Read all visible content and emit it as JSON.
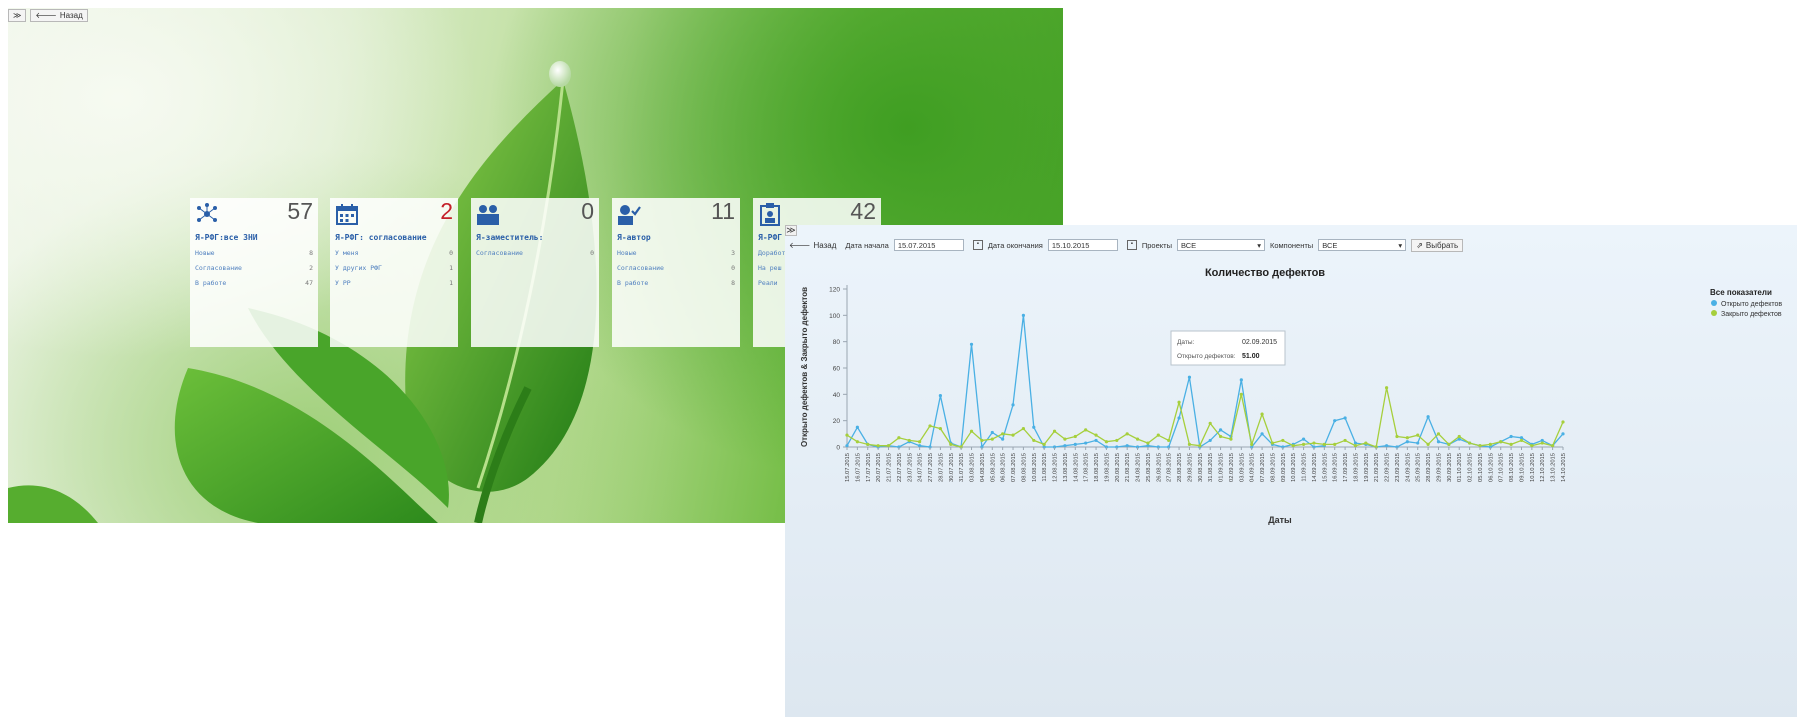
{
  "dashboard": {
    "expand_glyph": "≫",
    "back_label": "Назад",
    "tiles": [
      {
        "count": "57",
        "count_color": "#555555",
        "icon": "network-icon",
        "title": "Я-РФГ:все ЗНИ",
        "rows": [
          {
            "label": "Новые",
            "value": "8"
          },
          {
            "label": "Согласование",
            "value": "2"
          },
          {
            "label": "В работе",
            "value": "47"
          }
        ]
      },
      {
        "count": "2",
        "count_color": "#c4202a",
        "icon": "calendar-icon",
        "title": "Я-РФГ: согласование",
        "rows": [
          {
            "label": "У меня",
            "value": "0"
          },
          {
            "label": "У других РФГ",
            "value": "1"
          },
          {
            "label": "У РР",
            "value": "1"
          }
        ]
      },
      {
        "count": "0",
        "count_color": "#555555",
        "icon": "users-icon",
        "title": "Я-заместитель:",
        "rows": [
          {
            "label": "Согласование",
            "value": "0"
          }
        ]
      },
      {
        "count": "11",
        "count_color": "#555555",
        "icon": "user-check-icon",
        "title": "Я-автор",
        "rows": [
          {
            "label": "Новые",
            "value": "3"
          },
          {
            "label": "Согласование",
            "value": "0"
          },
          {
            "label": "В работе",
            "value": "8"
          }
        ]
      },
      {
        "count": "42",
        "count_color": "#555555",
        "icon": "clipboard-user-icon",
        "title": "Я-РФГ",
        "rows": [
          {
            "label": "Доработ",
            "value": ""
          },
          {
            "label": "На реш",
            "value": ""
          },
          {
            "label": "Реали",
            "value": ""
          }
        ]
      }
    ]
  },
  "chart_window": {
    "expand_glyph": "≫",
    "back_label": "Назад",
    "start_label": "Дата начала",
    "start_value": "15.07.2015",
    "end_label": "Дата окончания",
    "end_value": "15.10.2015",
    "projects_label": "Проекты",
    "projects_value": "ВСЕ",
    "components_label": "Компоненты",
    "components_value": "ВСЕ",
    "select_label": "Выбрать",
    "legend_title": "Все показатели",
    "tooltip": {
      "date_label": "Даты:",
      "date_value": "02.09.2015",
      "value_label": "Открыто дефектов:",
      "value_value": "51.00"
    }
  },
  "chart_data": {
    "type": "line",
    "title": "Количество дефектов",
    "xlabel": "Даты",
    "ylabel": "Открыто дефектов & Закрыто дефектов",
    "ylim": [
      0,
      120
    ],
    "yticks": [
      0,
      20,
      40,
      60,
      80,
      100,
      120
    ],
    "grid": false,
    "legend_position": "top-right",
    "categories": [
      "15.07.2015",
      "16.07.2015",
      "17.07.2015",
      "20.07.2015",
      "21.07.2015",
      "22.07.2015",
      "23.07.2015",
      "24.07.2015",
      "27.07.2015",
      "28.07.2015",
      "30.07.2015",
      "31.07.2015",
      "03.08.2015",
      "04.08.2015",
      "05.08.2015",
      "06.08.2015",
      "07.08.2015",
      "08.08.2015",
      "10.08.2015",
      "11.08.2015",
      "12.08.2015",
      "13.08.2015",
      "14.08.2015",
      "17.08.2015",
      "18.08.2015",
      "19.08.2015",
      "20.08.2015",
      "21.08.2015",
      "24.08.2015",
      "25.08.2015",
      "26.08.2015",
      "27.08.2015",
      "28.08.2015",
      "29.08.2015",
      "30.08.2015",
      "31.08.2015",
      "01.09.2015",
      "02.09.2015",
      "03.09.2015",
      "04.09.2015",
      "07.09.2015",
      "08.09.2015",
      "09.09.2015",
      "10.09.2015",
      "11.09.2015",
      "14.09.2015",
      "15.09.2015",
      "16.09.2015",
      "17.09.2015",
      "18.09.2015",
      "19.09.2015",
      "21.09.2015",
      "22.09.2015",
      "23.09.2015",
      "24.09.2015",
      "25.09.2015",
      "28.09.2015",
      "29.09.2015",
      "30.09.2015",
      "01.10.2015",
      "02.10.2015",
      "05.10.2015",
      "06.10.2015",
      "07.10.2015",
      "08.10.2015",
      "09.10.2015",
      "10.10.2015",
      "12.10.2015",
      "13.10.2015",
      "14.10.2015"
    ],
    "series": [
      {
        "name": "Открыто дефектов",
        "color": "#4ab0e4",
        "values": [
          1,
          15,
          2,
          0,
          1,
          0,
          4,
          1,
          0,
          39,
          3,
          0,
          78,
          0,
          11,
          6,
          32,
          100,
          15,
          0,
          0,
          1,
          2,
          3,
          5,
          0,
          0,
          1,
          0,
          1,
          0,
          0,
          22,
          53,
          0,
          5,
          13,
          8,
          51,
          0,
          10,
          2,
          0,
          2,
          6,
          0,
          1,
          20,
          22,
          3,
          2,
          0,
          1,
          0,
          4,
          3,
          23,
          4,
          2,
          6,
          3,
          1,
          0,
          4,
          8,
          7,
          2,
          5,
          1,
          10
        ]
      },
      {
        "name": "Закрыто дефектов",
        "color": "#a6cf3c",
        "values": [
          9,
          4,
          2,
          1,
          1,
          7,
          5,
          4,
          16,
          14,
          2,
          0,
          12,
          5,
          6,
          10,
          9,
          14,
          5,
          2,
          12,
          6,
          8,
          13,
          9,
          4,
          5,
          10,
          6,
          3,
          9,
          5,
          34,
          2,
          1,
          18,
          8,
          6,
          40,
          2,
          25,
          3,
          5,
          1,
          2,
          3,
          2,
          2,
          5,
          1,
          3,
          0,
          45,
          8,
          7,
          9,
          2,
          10,
          2,
          8,
          3,
          1,
          2,
          4,
          2,
          5,
          1,
          3,
          1,
          19
        ]
      }
    ]
  }
}
